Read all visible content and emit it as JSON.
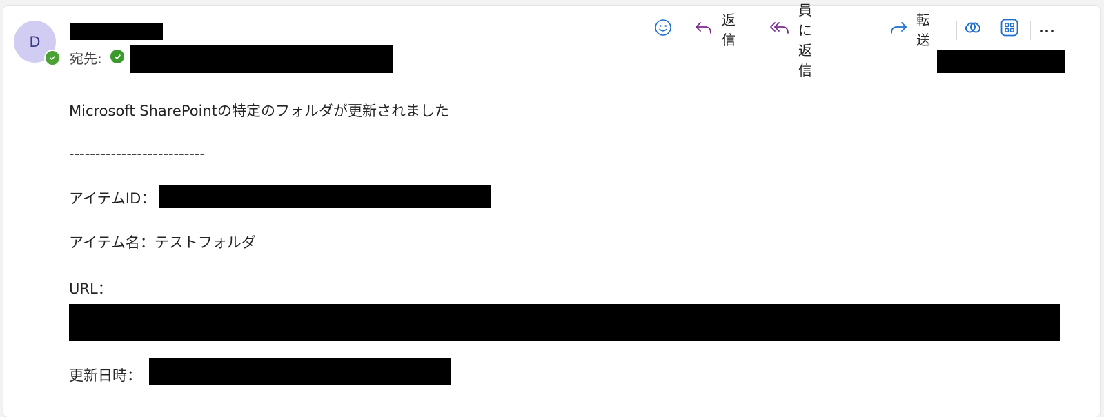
{
  "sender": {
    "initial": "D"
  },
  "recipients": {
    "label": "宛先:"
  },
  "toolbar": {
    "emoji_icon": "emoji-icon",
    "reply_label": "返信",
    "reply_all_label": "全員に返信",
    "forward_label": "転送",
    "more_icon": "more-icon",
    "accent_color": "#7b2d8e",
    "blue_color": "#1e6fcf"
  },
  "message": {
    "intro": "Microsoft SharePointの特定のフォルダが更新されました",
    "separator": "--------------------------",
    "item_id_label": "アイテムID：",
    "item_name_line": "アイテム名：テストフォルダ",
    "url_label": "URL：",
    "updated_label": "更新日時："
  }
}
